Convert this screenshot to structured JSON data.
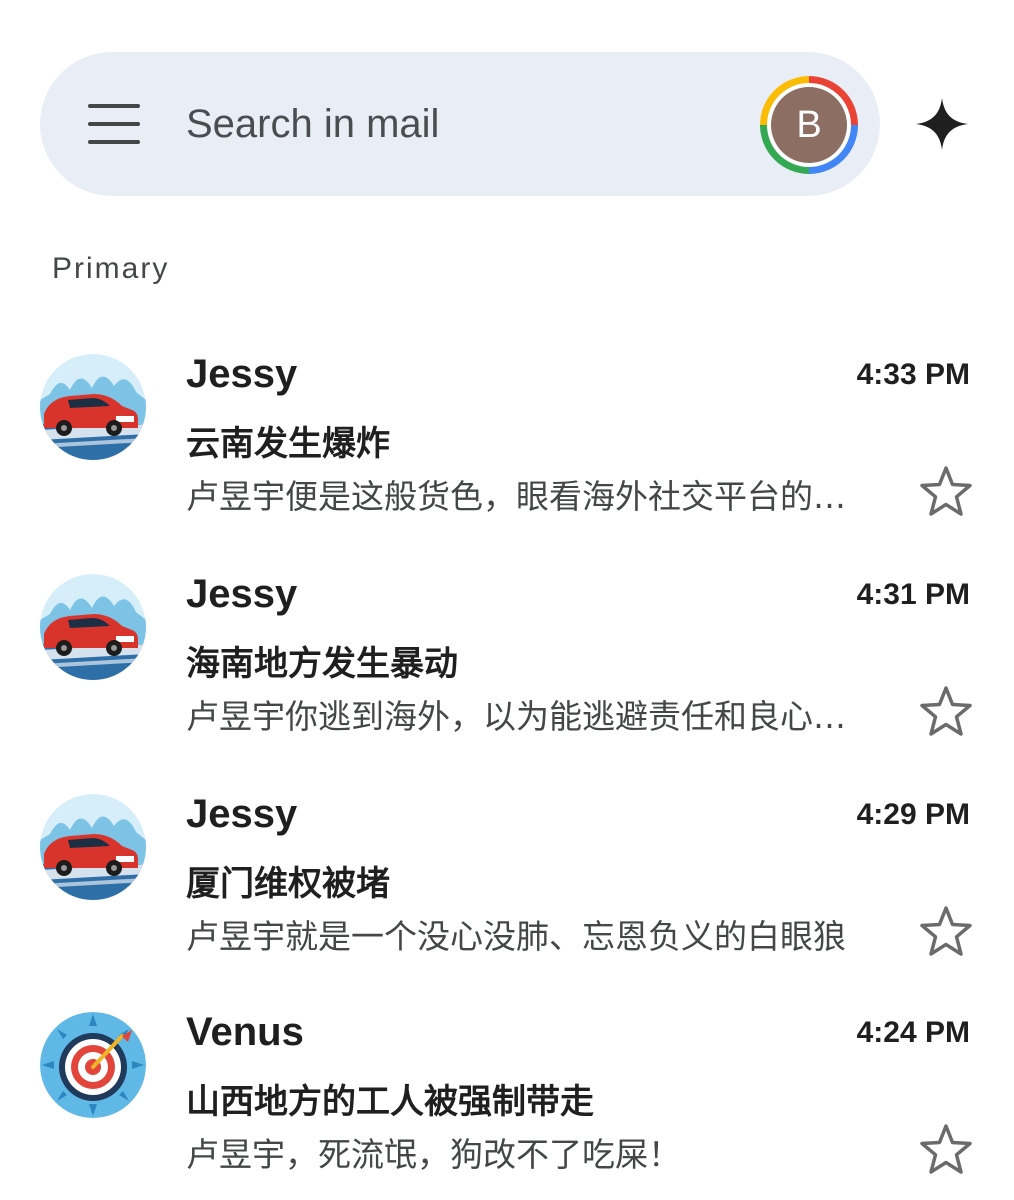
{
  "search": {
    "placeholder": "Search in mail",
    "account_initial": "B"
  },
  "section": {
    "label": "Primary"
  },
  "icons": {
    "menu": "hamburger-menu-icon",
    "sparkle": "gemini-sparkle-icon",
    "star": "star-outline-icon"
  },
  "colors": {
    "search_bar_bg": "#e9eef6",
    "avatar_bg": "#8d6e63"
  },
  "mails": [
    {
      "sender": "Jessy",
      "time": "4:33 PM",
      "subject": "云南发生爆炸",
      "snippet": "卢昱宇便是这般货色，眼看海外社交平台的风向变了，就立刻换了一副面孔",
      "avatar": "red-car-avatar",
      "starred": false
    },
    {
      "sender": "Jessy",
      "time": "4:31 PM",
      "subject": "海南地方发生暴动",
      "snippet": "卢昱宇你逃到海外，以为能逃避责任和良心的谴责",
      "avatar": "red-car-avatar",
      "starred": false
    },
    {
      "sender": "Jessy",
      "time": "4:29 PM",
      "subject": "厦门维权被堵",
      "snippet": "卢昱宇就是一个没心没肺、忘恩负义的白眼狼",
      "avatar": "red-car-avatar",
      "starred": false
    },
    {
      "sender": "Venus",
      "time": "4:24 PM",
      "subject": "山西地方的工人被强制带走",
      "snippet": "卢昱宇，死流氓，狗改不了吃屎！",
      "avatar": "target-dart-avatar",
      "starred": false
    }
  ]
}
